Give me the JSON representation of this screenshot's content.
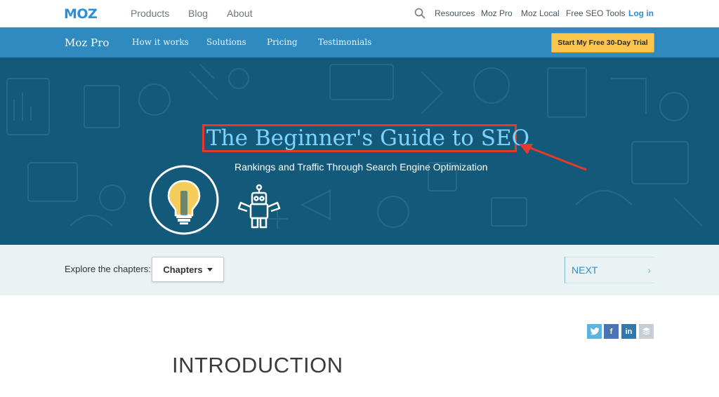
{
  "topnav": {
    "logo_text": "MOZ",
    "links": [
      "Products",
      "Blog",
      "About"
    ],
    "right_links": [
      "Resources",
      "Moz Pro",
      "Moz Local",
      "Free SEO Tools"
    ],
    "login": "Log in",
    "search_icon": "search-icon"
  },
  "subnav": {
    "brand": "Moz Pro",
    "links": [
      "How it works",
      "Solutions",
      "Pricing",
      "Testimonials"
    ],
    "cta": "Start My Free 30-Day Trial"
  },
  "hero": {
    "title": "The Beginner's Guide to SEO",
    "subtitle": "Rankings and Traffic Through Search Engine Optimization",
    "icons": [
      "lightbulb-icon",
      "robot-icon"
    ],
    "highlight_color": "#e53a2b",
    "background_color": "#13597a"
  },
  "chapters": {
    "label": "Explore the chapters:",
    "dropdown_label": "Chapters",
    "next_label": "NEXT"
  },
  "share_icons": [
    "twitter-icon",
    "facebook-icon",
    "linkedin-icon",
    "buffer-icon"
  ],
  "content": {
    "heading": "INTRODUCTION"
  },
  "colors": {
    "brand_blue": "#2a8fd6",
    "subnav_blue": "#2f8bbf",
    "cta_yellow": "#fbc54e",
    "chapters_bg": "#eaf3f3"
  }
}
